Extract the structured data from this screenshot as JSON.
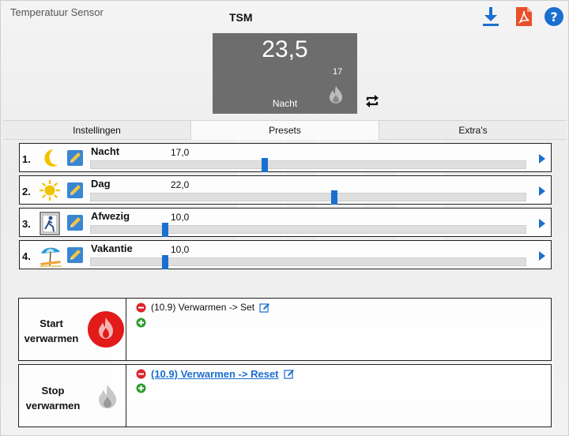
{
  "window": {
    "title": "Temperatuur Sensor"
  },
  "device": {
    "name": "TSM"
  },
  "toolbar": {
    "download_icon": "download-icon",
    "pdf_icon": "pdf-icon",
    "help_icon": "help-icon"
  },
  "display": {
    "temperature": "23,5",
    "setpoint": "17",
    "mode": "Nacht"
  },
  "tabs": [
    {
      "label": "Instellingen",
      "active": false
    },
    {
      "label": "Presets",
      "active": true
    },
    {
      "label": "Extra's",
      "active": false
    }
  ],
  "presets": [
    {
      "number": "1.",
      "name": "Nacht",
      "value": "17,0",
      "slider_fraction": 0.4,
      "icon": "moon-icon"
    },
    {
      "number": "2.",
      "name": "Dag",
      "value": "22,0",
      "slider_fraction": 0.56,
      "icon": "sun-icon"
    },
    {
      "number": "3.",
      "name": "Afwezig",
      "value": "10,0",
      "slider_fraction": 0.17,
      "icon": "exit-door-icon"
    },
    {
      "number": "4.",
      "name": "Vakantie",
      "value": "10,0",
      "slider_fraction": 0.17,
      "icon": "beach-umbrella-icon"
    }
  ],
  "actions": {
    "start": {
      "line1": "Start",
      "line2": "verwarmen",
      "item": "(10.9) Verwarmen -> Set"
    },
    "stop": {
      "line1": "Stop",
      "line2": "verwarmen",
      "item": "(10.9) Verwarmen -> Reset"
    }
  },
  "colors": {
    "accent": "#1a6fd0",
    "display_bg": "#6d6d6d",
    "flame_active": "#e21a1a",
    "remove": "#d9262c",
    "add": "#2f9a2f"
  }
}
